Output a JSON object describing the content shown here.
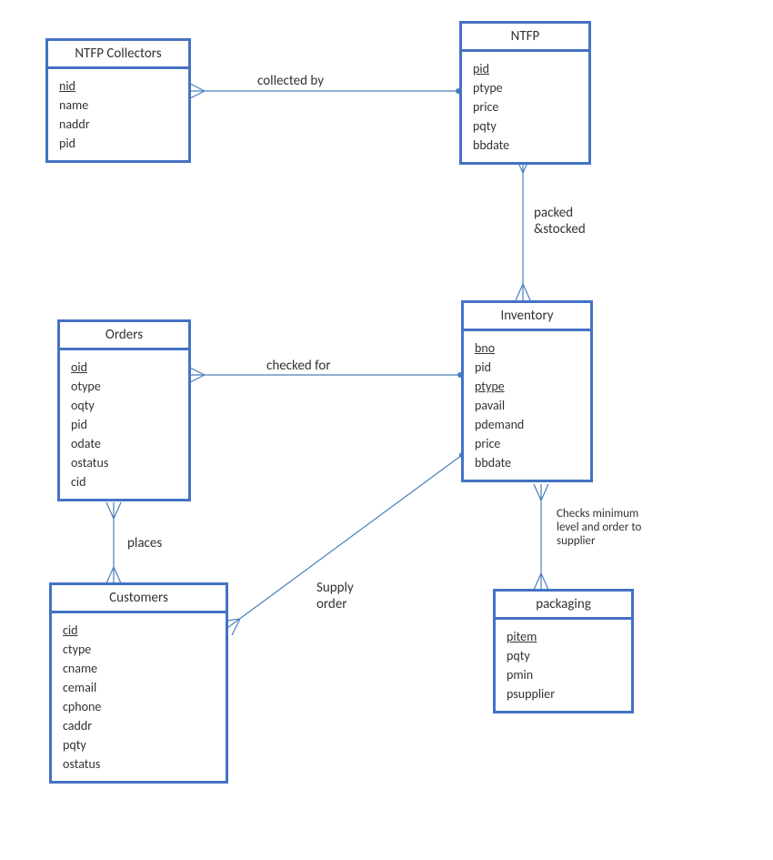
{
  "entities": {
    "ntfp_collectors": {
      "title": "NTFP Collectors",
      "attrs": [
        "nid",
        "name",
        "naddr",
        "pid"
      ],
      "keys": [
        "nid"
      ]
    },
    "ntfp": {
      "title": "NTFP",
      "attrs": [
        "pid",
        "ptype",
        "price",
        "pqty",
        "bbdate"
      ],
      "keys": [
        "pid"
      ]
    },
    "orders": {
      "title": "Orders",
      "attrs": [
        "oid",
        "otype",
        "oqty",
        "pid",
        "odate",
        "ostatus",
        "cid"
      ],
      "keys": [
        "oid"
      ]
    },
    "inventory": {
      "title": "Inventory",
      "attrs": [
        "bno",
        "pid",
        "ptype",
        "pavail",
        "pdemand",
        "price",
        "bbdate"
      ],
      "keys": [
        "bno",
        "ptype"
      ]
    },
    "customers": {
      "title": "Customers",
      "attrs": [
        "cid",
        "ctype",
        "cname",
        "cemail",
        "cphone",
        "caddr",
        "pqty",
        "ostatus"
      ],
      "keys": [
        "cid"
      ]
    },
    "packaging": {
      "title": "packaging",
      "attrs": [
        "pitem",
        "pqty",
        "pmin",
        "psupplier"
      ],
      "keys": [
        "pitem"
      ]
    }
  },
  "relationships": {
    "collected_by": "collected by",
    "packed_stocked": "packed\n&stocked",
    "checked_for": "checked for",
    "places": "places",
    "supply_order": "Supply\norder",
    "checks_min_order": "Checks minimum\nlevel and order to\nsupplier"
  }
}
